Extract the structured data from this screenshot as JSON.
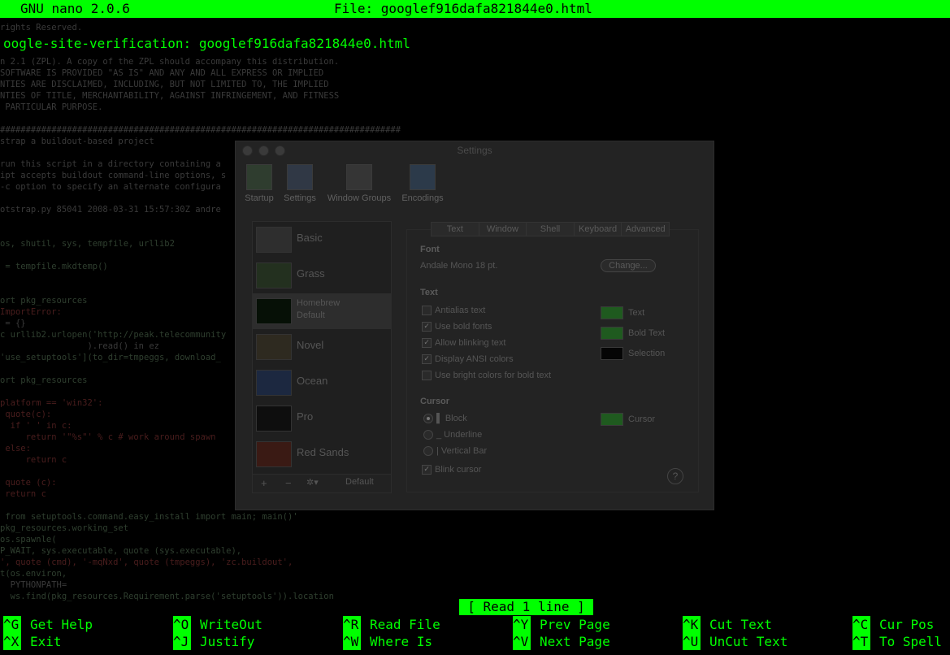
{
  "nano": {
    "version": "GNU nano 2.0.6",
    "file_label": "File: googlef916dafa821844e0.html",
    "content_line": "oogle-site-verification: googlef916dafa821844e0.html",
    "status": "[ Read 1 line ]"
  },
  "shortcuts": [
    {
      "key": "^G",
      "label": "Get Help"
    },
    {
      "key": "^O",
      "label": "WriteOut"
    },
    {
      "key": "^R",
      "label": "Read File"
    },
    {
      "key": "^Y",
      "label": "Prev Page"
    },
    {
      "key": "^K",
      "label": "Cut Text"
    },
    {
      "key": "^C",
      "label": "Cur Pos"
    },
    {
      "key": "^X",
      "label": "Exit"
    },
    {
      "key": "^J",
      "label": "Justify"
    },
    {
      "key": "^W",
      "label": "Where Is"
    },
    {
      "key": "^V",
      "label": "Next Page"
    },
    {
      "key": "^U",
      "label": "UnCut Text"
    },
    {
      "key": "^T",
      "label": "To Spell"
    }
  ],
  "ghost_lines": [
    "rights Reserved.",
    "n 2.1 (ZPL). A copy of the ZPL should accompany this distribution.",
    "SOFTWARE IS PROVIDED \"AS IS\" AND ANY AND ALL EXPRESS OR IMPLIED",
    "NTIES ARE DISCLAIMED, INCLUDING, BUT NOT LIMITED TO, THE IMPLIED",
    "NTIES OF TITLE, MERCHANTABILITY, AGAINST INFRINGEMENT, AND FITNESS",
    " PARTICULAR PURPOSE.",
    "##############################################################################",
    "strap a buildout-based project",
    "run this script in a directory containing a",
    "ipt accepts buildout command-line options, s",
    "-c option to specify an alternate configura",
    "otstrap.py 85041 2008-03-31 15:57:30Z andre",
    "os, shutil, sys, tempfile, urllib2",
    " = tempfile.mkdtemp()",
    "ort pkg_resources",
    "ImportError:",
    " = {}",
    "c urllib2.urlopen('http://peak.telecommunity",
    "                 ).read() in ez",
    "'use_setuptools'](to_dir=tmpeggs, download_",
    "ort pkg_resources",
    "platform == 'win32':",
    " quote(c):",
    "  if ' ' in c:",
    "     return '\"%s\"' % c # work around spawn",
    " else:",
    "     return c",
    " quote (c):",
    " return c",
    " from setuptools.command.easy_install import main; main()'",
    "pkg_resources.working_set",
    "os.spawnle(",
    "P_WAIT, sys.executable, quote (sys.executable),",
    "', quote (cmd), '-mqNxd', quote (tmpeggs), 'zc.buildout',",
    "t(os.environ,",
    "  PYTHONPATH=",
    "  ws.find(pkg_resources.Requirement.parse('setuptools')).location",
    " ),"
  ],
  "settings": {
    "title": "Settings",
    "toolbar": [
      "Startup",
      "Settings",
      "Window Groups",
      "Encodings"
    ],
    "profiles": [
      "Basic",
      "Grass",
      "Homebrew\nDefault",
      "Novel",
      "Ocean",
      "Pro",
      "Red Sands"
    ],
    "profile_tools": {
      "add": "+",
      "remove": "−",
      "gear": "✲▾",
      "default": "Default"
    },
    "tabs": [
      "Text",
      "Window",
      "Shell",
      "Keyboard",
      "Advanced"
    ],
    "font_heading": "Font",
    "font_value": "Andale Mono 18 pt.",
    "change_button": "Change...",
    "text_heading": "Text",
    "options": [
      {
        "label": "Antialias text",
        "checked": false
      },
      {
        "label": "Use bold fonts",
        "checked": true
      },
      {
        "label": "Allow blinking text",
        "checked": true
      },
      {
        "label": "Display ANSI colors",
        "checked": true
      },
      {
        "label": "Use bright colors for bold text",
        "checked": false
      }
    ],
    "colors": [
      {
        "label": "Text",
        "color": "#1f5a1f"
      },
      {
        "label": "Bold Text",
        "color": "#1f5a1f"
      },
      {
        "label": "Selection",
        "color": "#050505"
      }
    ],
    "cursor_heading": "Cursor",
    "cursor_options": [
      {
        "label": "▌ Block",
        "selected": true
      },
      {
        "label": "_ Underline",
        "selected": false
      },
      {
        "label": "| Vertical Bar",
        "selected": false
      }
    ],
    "cursor_color_label": "Cursor",
    "blink_cursor": "Blink cursor",
    "help": "?"
  }
}
